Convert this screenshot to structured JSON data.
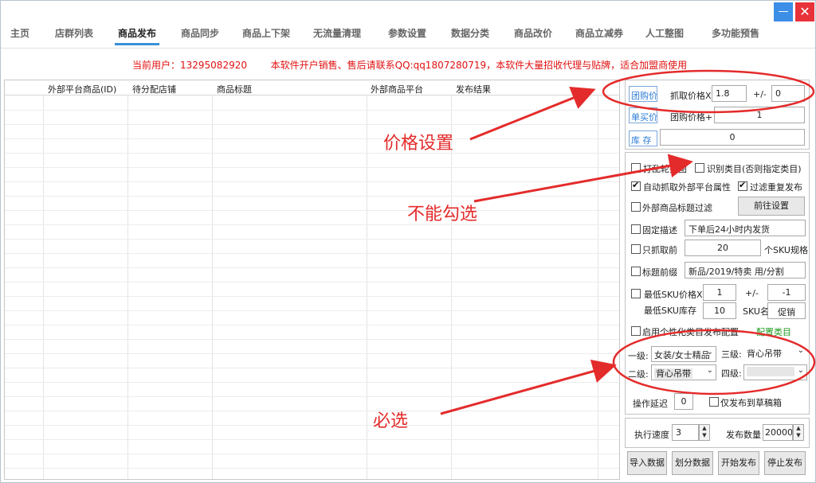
{
  "window": {
    "minimize_glyph": "—",
    "close_glyph": "✕"
  },
  "tabs": [
    {
      "label": "主页"
    },
    {
      "label": "店群列表"
    },
    {
      "label": "商品发布"
    },
    {
      "label": "商品同步"
    },
    {
      "label": "商品上下架"
    },
    {
      "label": "无流量清理"
    },
    {
      "label": "参数设置"
    },
    {
      "label": "数据分类"
    },
    {
      "label": "商品改价"
    },
    {
      "label": "商品立减券"
    },
    {
      "label": "人工整图"
    },
    {
      "label": "多功能预售"
    }
  ],
  "notice": {
    "user": "当前用户：13295082920",
    "ad": "本软件开户销售、售后请联系QQ:qq1807280719，本软件大量招收代理与贴牌，适合加盟商使用"
  },
  "grid": {
    "columns": [
      "外部平台商品(ID)",
      "待分配店铺",
      "商品标题",
      "外部商品平台",
      "发布结果"
    ]
  },
  "price": {
    "tuangou_tag": "团购价",
    "grab_label": "抓取价格X",
    "multiplier": "1.8",
    "plusminus": "+/-",
    "offset": "0",
    "danmai_tag": "单买价",
    "group_label": "团购价格+",
    "group_plus": "1",
    "stock_tag": "库  存",
    "stock_value": "0"
  },
  "options": {
    "shuffle_main": "打乱轮播图",
    "recognize_category": "识别类目(否则指定类目)",
    "auto_attr": "自动抓取外部平台属性",
    "filter_dup": "过滤重复发布",
    "title_filter": "外部商品标题过滤",
    "goto_settings": "前往设置",
    "fixed_desc": "固定描述",
    "fixed_desc_value": "下单后24小时内发货",
    "only_grab_front": "只抓取前",
    "sku_count": "20",
    "sku_unit": "个SKU规格",
    "title_prefix": "标题前缀",
    "title_prefix_value": "新品/2019/特卖 用/分割",
    "min_sku_price": "最低SKU价格X",
    "min_sku_mult": "1",
    "min_sku_pm": "+/-",
    "min_sku_offset": "-1",
    "min_sku_stock_label": "最低SKU库存",
    "min_sku_stock": "10",
    "sku_name_label": "SKU名",
    "sku_name": "促销",
    "personal_cat": "启用个性化类目发布配置",
    "config_cat": "配置类目"
  },
  "category": {
    "l1_label": "一级:",
    "l1_value": "女装/女士精品",
    "l3_label": "三级:",
    "l3_value": "背心吊带",
    "l2_label": "二级:",
    "l2_value": "背心吊带",
    "l4_label": "四级:",
    "l4_value": ""
  },
  "delay": {
    "label": "操作延迟",
    "value": "0",
    "draft_label": "仅发布到草稿箱"
  },
  "exec": {
    "speed_label": "执行速度",
    "speed": "3",
    "count_label": "发布数量",
    "count": "20000"
  },
  "actions": {
    "import": "导入数据",
    "split": "划分数据",
    "start": "开始发布",
    "stop": "停止发布"
  },
  "annotations": {
    "price_setting": "价格设置",
    "cannot_check": "不能勾选",
    "required": "必选"
  },
  "colors": {
    "annotation": "#e42b2b",
    "active_tab": "#3b8fd9",
    "notice": "#e01010"
  }
}
